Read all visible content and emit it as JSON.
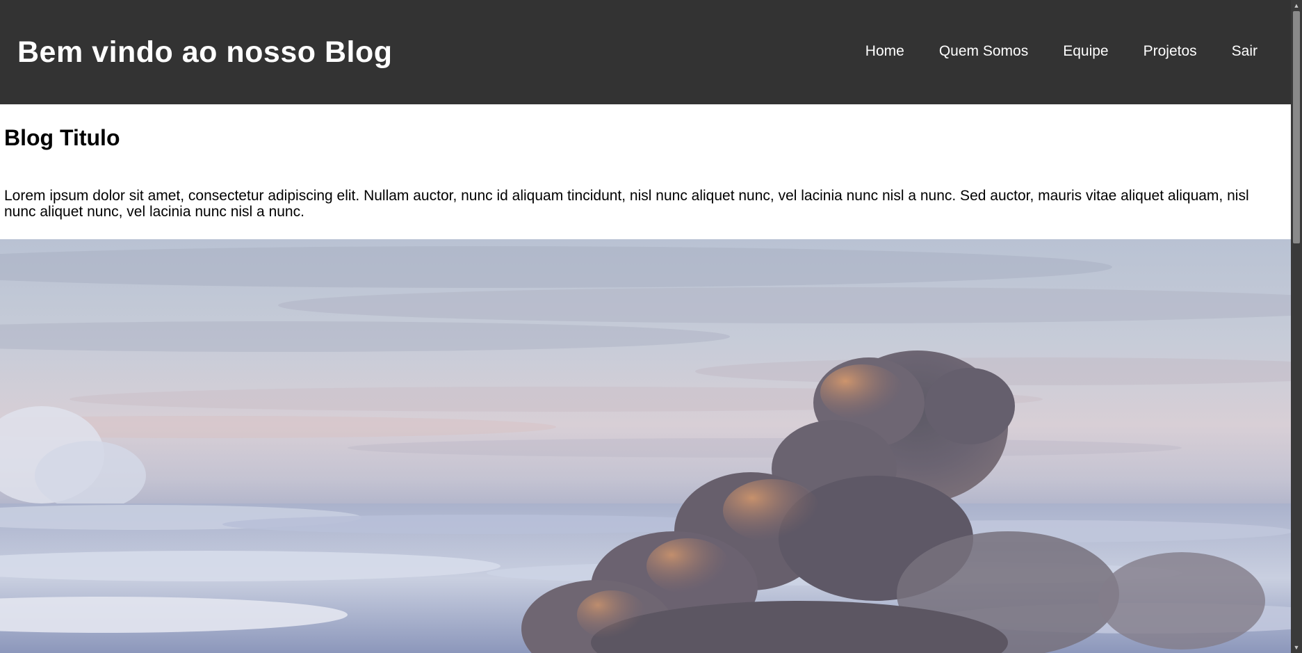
{
  "header": {
    "title": "Bem vindo ao nosso Blog",
    "nav": [
      {
        "label": "Home"
      },
      {
        "label": "Quem Somos"
      },
      {
        "label": "Equipe"
      },
      {
        "label": "Projetos"
      },
      {
        "label": "Sair"
      }
    ]
  },
  "article": {
    "title": "Blog Titulo",
    "body": "Lorem ipsum dolor sit amet, consectetur adipiscing elit. Nullam auctor, nunc id aliquam tincidunt, nisl nunc aliquet nunc, vel lacinia nunc nisl a nunc. Sed auctor, mauris vitae aliquet aliquam, nisl nunc aliquet nunc, vel lacinia nunc nisl a nunc."
  },
  "colors": {
    "header_bg": "#333333",
    "header_text": "#ffffff",
    "body_text": "#000000",
    "scrollbar_track": "#3a3a3a",
    "scrollbar_thumb": "#8a8a8a"
  },
  "scrollbar": {
    "up_icon": "chevron-up-icon",
    "down_icon": "chevron-down-icon"
  }
}
